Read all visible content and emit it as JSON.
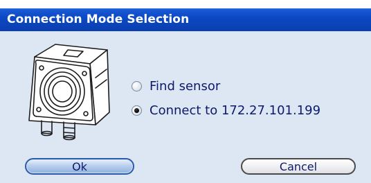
{
  "dialog": {
    "title": "Connection Mode Selection"
  },
  "icon": {
    "name": "camera-sensor-icon"
  },
  "options": [
    {
      "label": "Find sensor",
      "selected": false
    },
    {
      "label": "Connect to 172.27.101.199",
      "selected": true
    }
  ],
  "buttons": {
    "ok_label": "Ok",
    "cancel_label": "Cancel"
  },
  "colors": {
    "titlebar": "#0c48c3",
    "client_bg": "#dde6f3",
    "text": "#0b1a6b"
  }
}
